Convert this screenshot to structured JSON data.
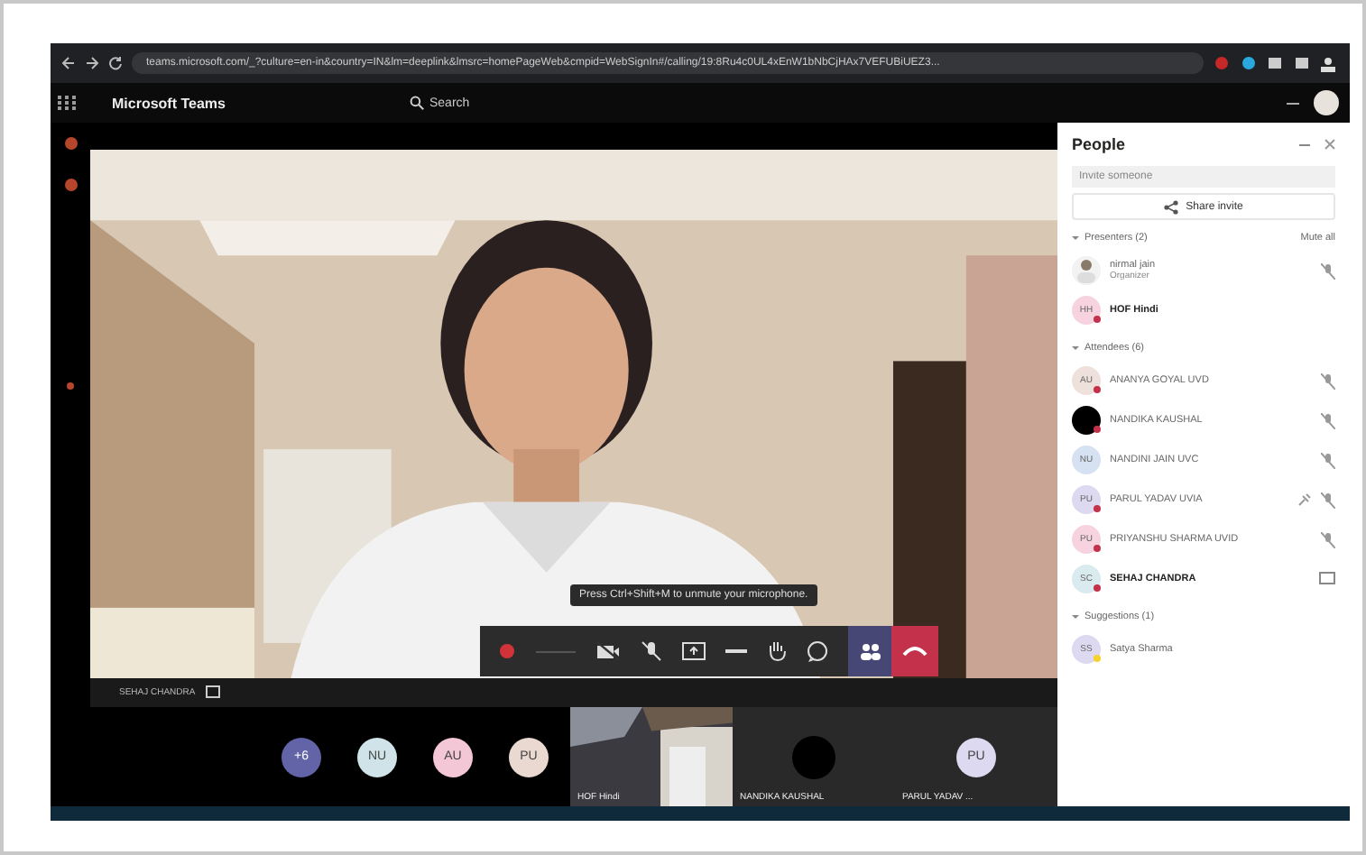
{
  "browser": {
    "url": "teams.microsoft.com/_?culture=en-in&country=IN&lm=deeplink&lmsrc=homePageWeb&cmpid=WebSignIn#/calling/19:8Ru4c0UL4xEnW1bNbCjHAx7VEFUBiUEZ3..."
  },
  "app": {
    "title": "Microsoft Teams",
    "search_placeholder": "Search"
  },
  "stage": {
    "kind": "picture",
    "name_label": "SEHAJ CHANDRA",
    "tooltip": "Press Ctrl+Shift+M to unmute your microphone."
  },
  "gallery": {
    "avatars": [
      {
        "initials": "+6",
        "color": "#6264a7"
      },
      {
        "initials": "NU",
        "color": "#cfe3e8"
      },
      {
        "initials": "AU",
        "color": "#f3c7d6"
      },
      {
        "initials": "PU",
        "color": "#ead9d0"
      }
    ],
    "tiles": [
      {
        "kind": "video",
        "name": "HOF Hindi"
      },
      {
        "kind": "dark-avatar",
        "name": "NANDIKA KAUSHAL"
      },
      {
        "kind": "initials",
        "initials": "PU",
        "name": "PARUL YADAV ..."
      }
    ]
  },
  "people": {
    "title": "People",
    "invite_placeholder": "Invite someone",
    "share_label": "Share invite",
    "mute_all": "Mute all",
    "sections": [
      {
        "title": "Presenters (2)",
        "members": [
          {
            "name": "nirmal jain",
            "role": "Organizer",
            "bold": false,
            "muted": true,
            "pinned": false,
            "sharing": false
          },
          {
            "name": "HOF Hindi",
            "kind": "initials",
            "initials": "HH",
            "color": "#c4314b",
            "bold": true,
            "muted": false,
            "pinned": false,
            "sharing": false
          }
        ]
      },
      {
        "title": "Attendees (6)",
        "members": [
          {
            "name": "ANANYA GOYAL UVD",
            "kind": "initials",
            "initials": "AU",
            "color": "#c4314b",
            "bold": false,
            "muted": true,
            "pinned": false,
            "sharing": false
          },
          {
            "name": "NANDIKA KAUSHAL",
            "kind": "dark",
            "color": "#c4314b",
            "bold": false,
            "muted": true,
            "pinned": false,
            "sharing": false
          },
          {
            "name": "NANDINI JAIN UVC",
            "kind": "initials",
            "initials": "NU",
            "bold": false,
            "muted": true,
            "pinned": false,
            "sharing": false
          },
          {
            "name": "PARUL YADAV UVIA",
            "kind": "initials",
            "initials": "PU",
            "color": "#c4314b",
            "bold": false,
            "muted": true,
            "pinned": true,
            "sharing": false
          },
          {
            "name": "PRIYANSHU SHARMA UVID",
            "kind": "initials",
            "initials": "PU",
            "color": "#c4314b",
            "bold": false,
            "muted": true,
            "pinned": false,
            "sharing": false
          },
          {
            "name": "SEHAJ CHANDRA",
            "kind": "initials",
            "initials": "SC",
            "color": "#c4314b",
            "bold": true,
            "muted": false,
            "pinned": false,
            "sharing": true
          }
        ]
      },
      {
        "title": "Suggestions (1)",
        "members": [
          {
            "name": "Satya Sharma",
            "kind": "initials",
            "initials": "SS",
            "color": "#f8d22a",
            "bold": false,
            "muted": false,
            "pinned": false,
            "sharing": false
          }
        ]
      }
    ]
  }
}
